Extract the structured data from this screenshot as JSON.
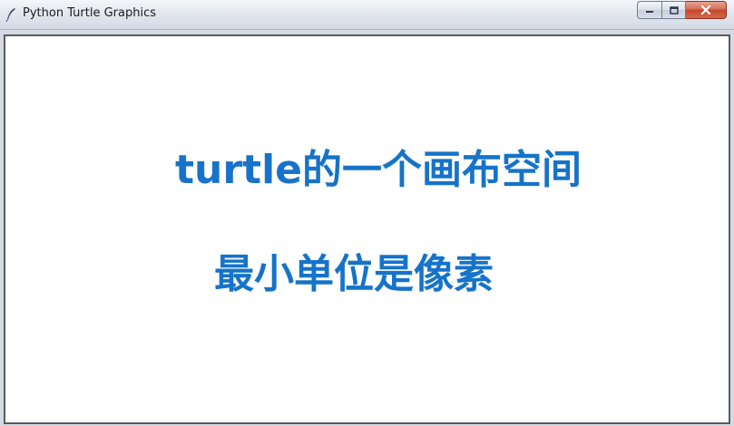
{
  "window": {
    "title": "Python Turtle Graphics",
    "icon": "feather-icon"
  },
  "controls": {
    "minimize_icon": "minimize-icon",
    "maximize_icon": "maximize-icon",
    "close_icon": "close-icon"
  },
  "canvas": {
    "line1": "turtle的一个画布空间",
    "line2": "最小单位是像素",
    "text_color": "#1673c9"
  }
}
